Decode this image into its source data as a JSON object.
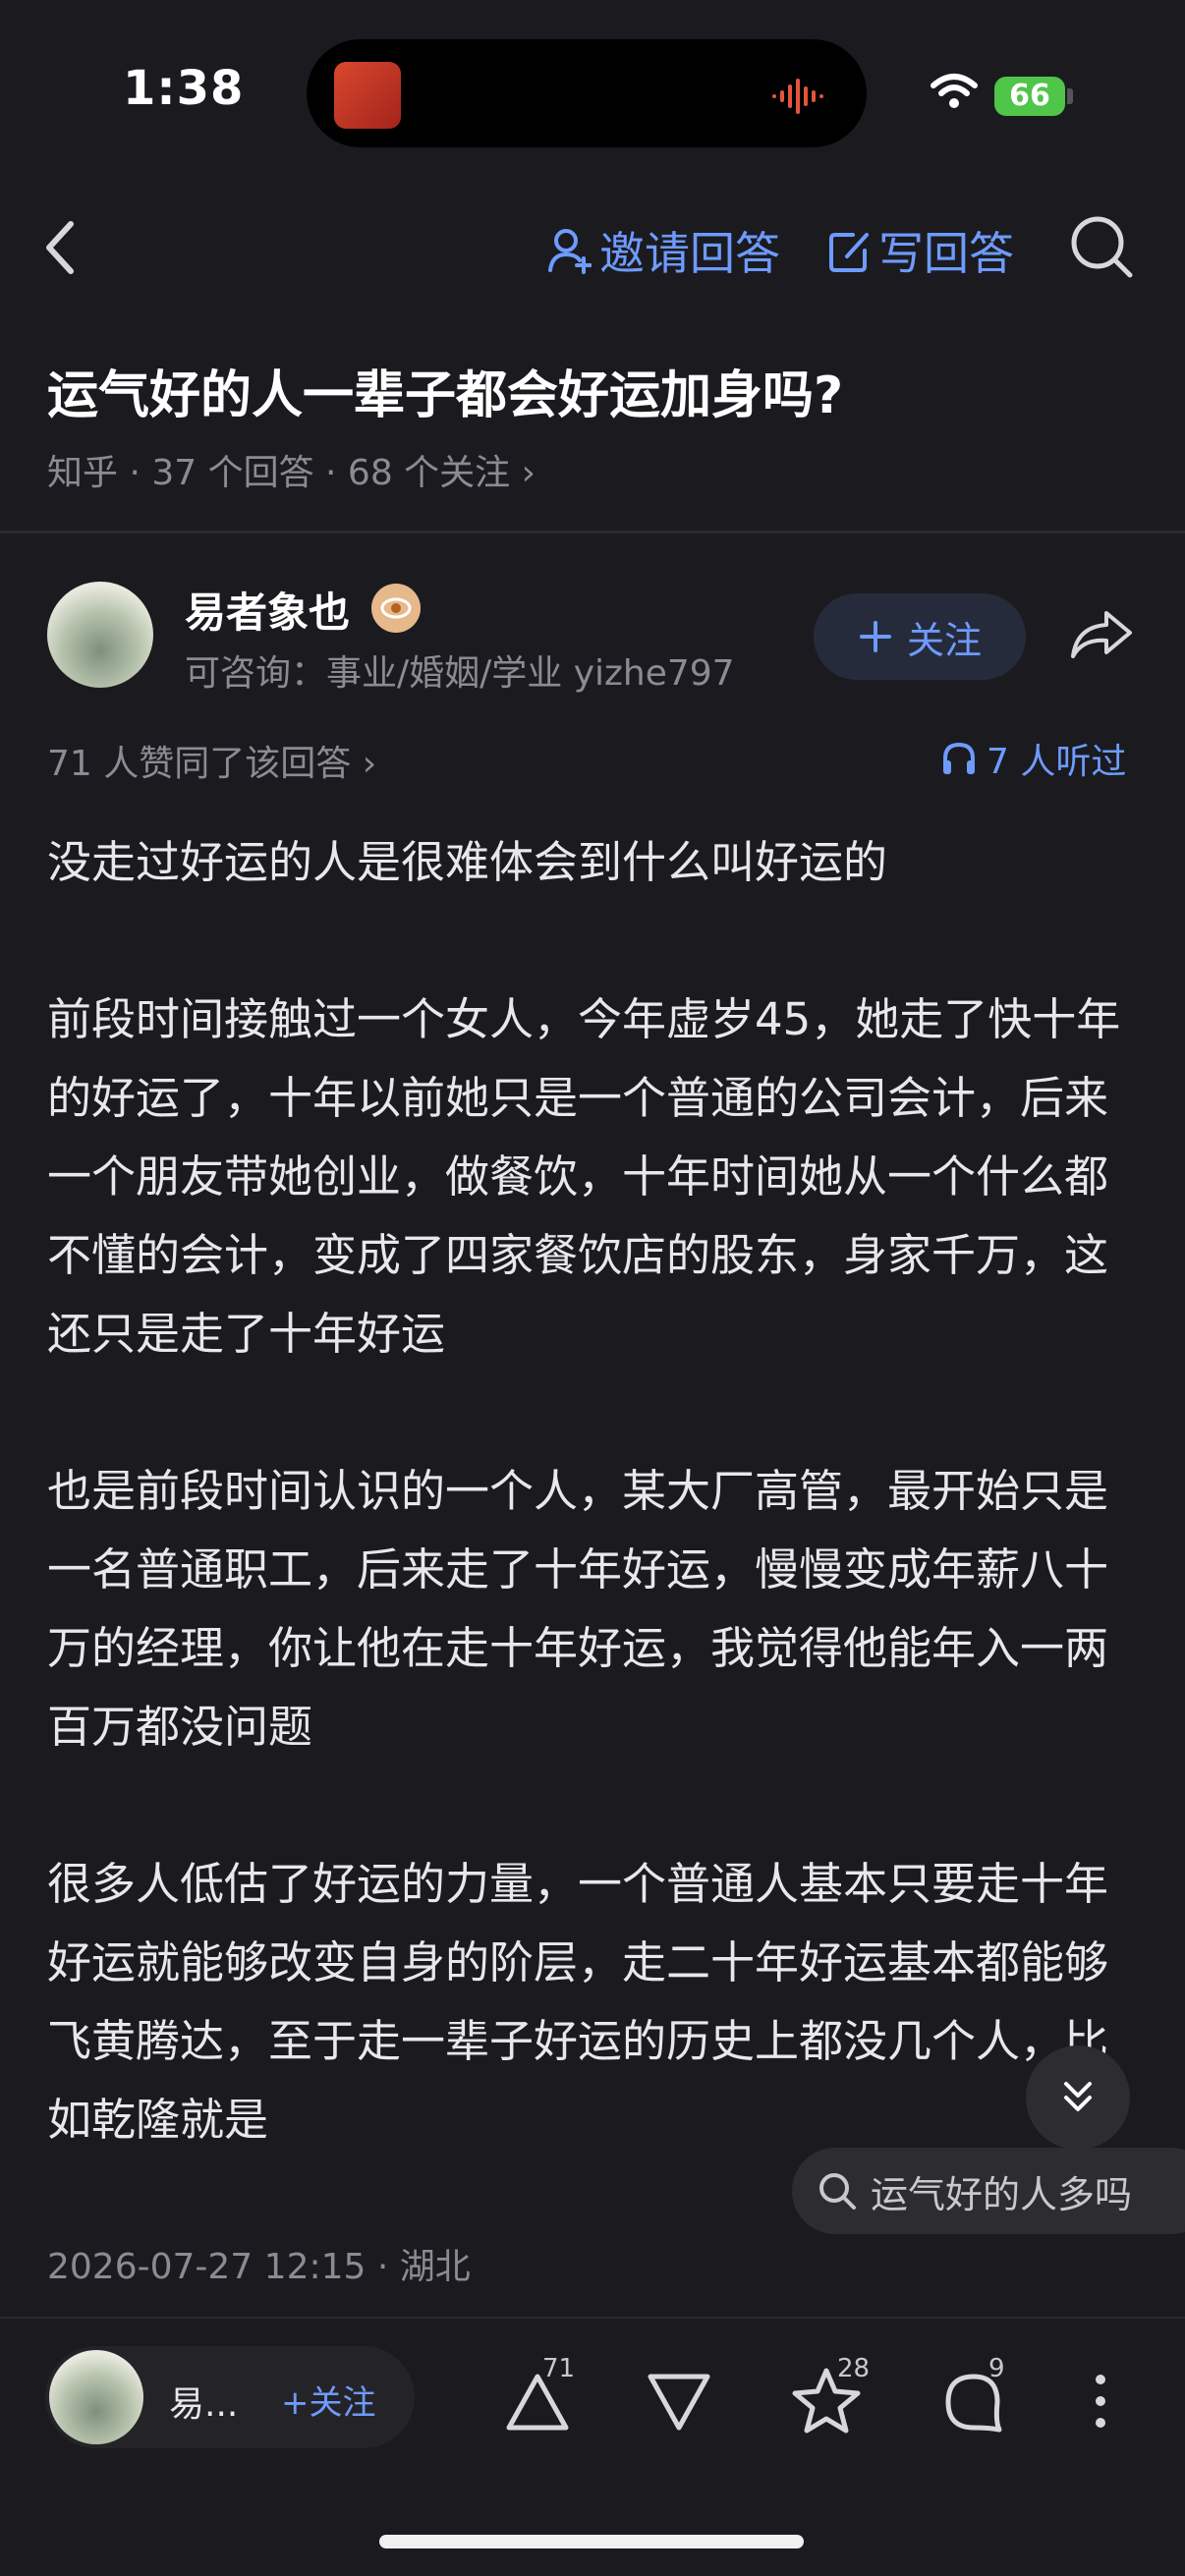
{
  "status_bar": {
    "time": "1:38",
    "battery": "66"
  },
  "nav": {
    "invite_label": "邀请回答",
    "write_label": "写回答"
  },
  "question": {
    "title": "运气好的人一辈子都会好运加身吗?",
    "meta": "知乎 · 37 个回答 · 68 个关注 ›"
  },
  "author": {
    "name": "易者象也",
    "bio": "可咨询：事业/婚姻/学业  yizhe797",
    "follow_label": "关注"
  },
  "answer": {
    "likes_text": "71 人赞同了该回答 ›",
    "listened_text": "7 人听过",
    "paragraphs": [
      "没走过好运的人是很难体会到什么叫好运的",
      "前段时间接触过一个女人，今年虚岁45，她走了快十年的好运了，十年以前她只是一个普通的公司会计，后来一个朋友带她创业，做餐饮，十年时间她从一个什么都不懂的会计，变成了四家餐饮店的股东，身家千万，这还只是走了十年好运",
      "也是前段时间认识的一个人，某大厂高管，最开始只是一名普通职工，后来走了十年好运，慢慢变成年薪八十万的经理，你让他在走十年好运，我觉得他能年入一两百万都没问题",
      "很多人低估了好运的力量，一个普通人基本只要走十年好运就能够改变自身的阶层，走二十年好运基本都能够飞黄腾达，至于走一辈子好运的历史上都没几个人，比如乾隆就是"
    ],
    "date": "2026-07-27 12:15 · 湖北"
  },
  "related_search": "运气好的人多吗",
  "bottom_bar": {
    "author_short": "易...",
    "follow_label": "+关注",
    "upvote_count": "71",
    "star_count": "28",
    "comment_count": "9"
  },
  "colors": {
    "background": "#1b1b1f",
    "accent": "#6e9bff",
    "muted": "#8b8b94"
  }
}
